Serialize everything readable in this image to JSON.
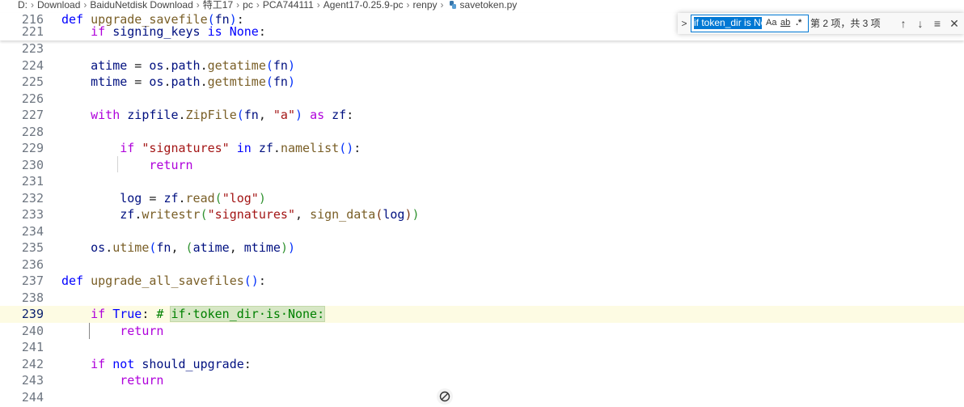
{
  "breadcrumb": [
    "D:",
    "Download",
    "BaiduNetdisk Download",
    "特工17",
    "pc",
    "PCA744111",
    "Agent17-0.25.9-pc",
    "renpy",
    "savetoken.py"
  ],
  "sticky": [
    {
      "ln": "216",
      "text": "def upgrade_savefile(fn):"
    },
    {
      "ln": "221",
      "text": "    if signing_keys is None:"
    }
  ],
  "lines": [
    {
      "ln": "223"
    },
    {
      "ln": "224"
    },
    {
      "ln": "225"
    },
    {
      "ln": "226"
    },
    {
      "ln": "227"
    },
    {
      "ln": "228"
    },
    {
      "ln": "229"
    },
    {
      "ln": "230"
    },
    {
      "ln": "231"
    },
    {
      "ln": "232"
    },
    {
      "ln": "233"
    },
    {
      "ln": "234"
    },
    {
      "ln": "235"
    },
    {
      "ln": "236"
    },
    {
      "ln": "237"
    },
    {
      "ln": "238"
    },
    {
      "ln": "239"
    },
    {
      "ln": "240"
    },
    {
      "ln": "241"
    },
    {
      "ln": "242"
    },
    {
      "ln": "243"
    },
    {
      "ln": "244"
    }
  ],
  "code": {
    "l216_def": "def",
    "l216_name": "upgrade_savefile",
    "l216_arg": "fn",
    "l221_if": "if",
    "l221_var": "signing_keys",
    "l221_is": "is",
    "l221_none": "None",
    "l224_var": "atime",
    "l224_mod": "os",
    "l224_attr": "path",
    "l224_fn": "getatime",
    "l224_arg": "fn",
    "l225_var": "mtime",
    "l225_mod": "os",
    "l225_attr": "path",
    "l225_fn": "getmtime",
    "l225_arg": "fn",
    "l227_with": "with",
    "l227_mod": "zipfile",
    "l227_cls": "ZipFile",
    "l227_arg": "fn",
    "l227_str": "\"a\"",
    "l227_as": "as",
    "l227_var": "zf",
    "l229_if": "if",
    "l229_str": "\"signatures\"",
    "l229_in": "in",
    "l229_var": "zf",
    "l229_fn": "namelist",
    "l230_return": "return",
    "l232_var": "log",
    "l232_obj": "zf",
    "l232_fn": "read",
    "l232_str": "\"log\"",
    "l233_obj": "zf",
    "l233_fn": "writestr",
    "l233_str": "\"signatures\"",
    "l233_fn2": "sign_data",
    "l233_arg": "log",
    "l235_mod": "os",
    "l235_fn": "utime",
    "l235_arg": "fn",
    "l235_a1": "atime",
    "l235_a2": "mtime",
    "l237_def": "def",
    "l237_name": "upgrade_all_savefiles",
    "l239_if": "if",
    "l239_true": "True",
    "l239_hash": "# ",
    "l239_match": "if·token_dir·is·None:",
    "l240_return": "return",
    "l242_if": "if",
    "l242_not": "not",
    "l242_var": "should_upgrade",
    "l243_return": "return"
  },
  "find": {
    "query": "if token_dir is No",
    "match_case": "Aa",
    "whole_word": "ab",
    "regex": ".*",
    "count": "第 2 项，共 3 项",
    "toggle": ">",
    "prev": "↑",
    "next": "↓",
    "in_selection": "≡",
    "close": "✕"
  },
  "colors": {
    "keyword": "#0000ff",
    "control": "#af00db",
    "function": "#795e26",
    "string": "#a31515",
    "comment": "#008000",
    "match_highlight": "#d7e7c5",
    "current_line": "#fdfbe3",
    "focus": "#0078d4"
  }
}
